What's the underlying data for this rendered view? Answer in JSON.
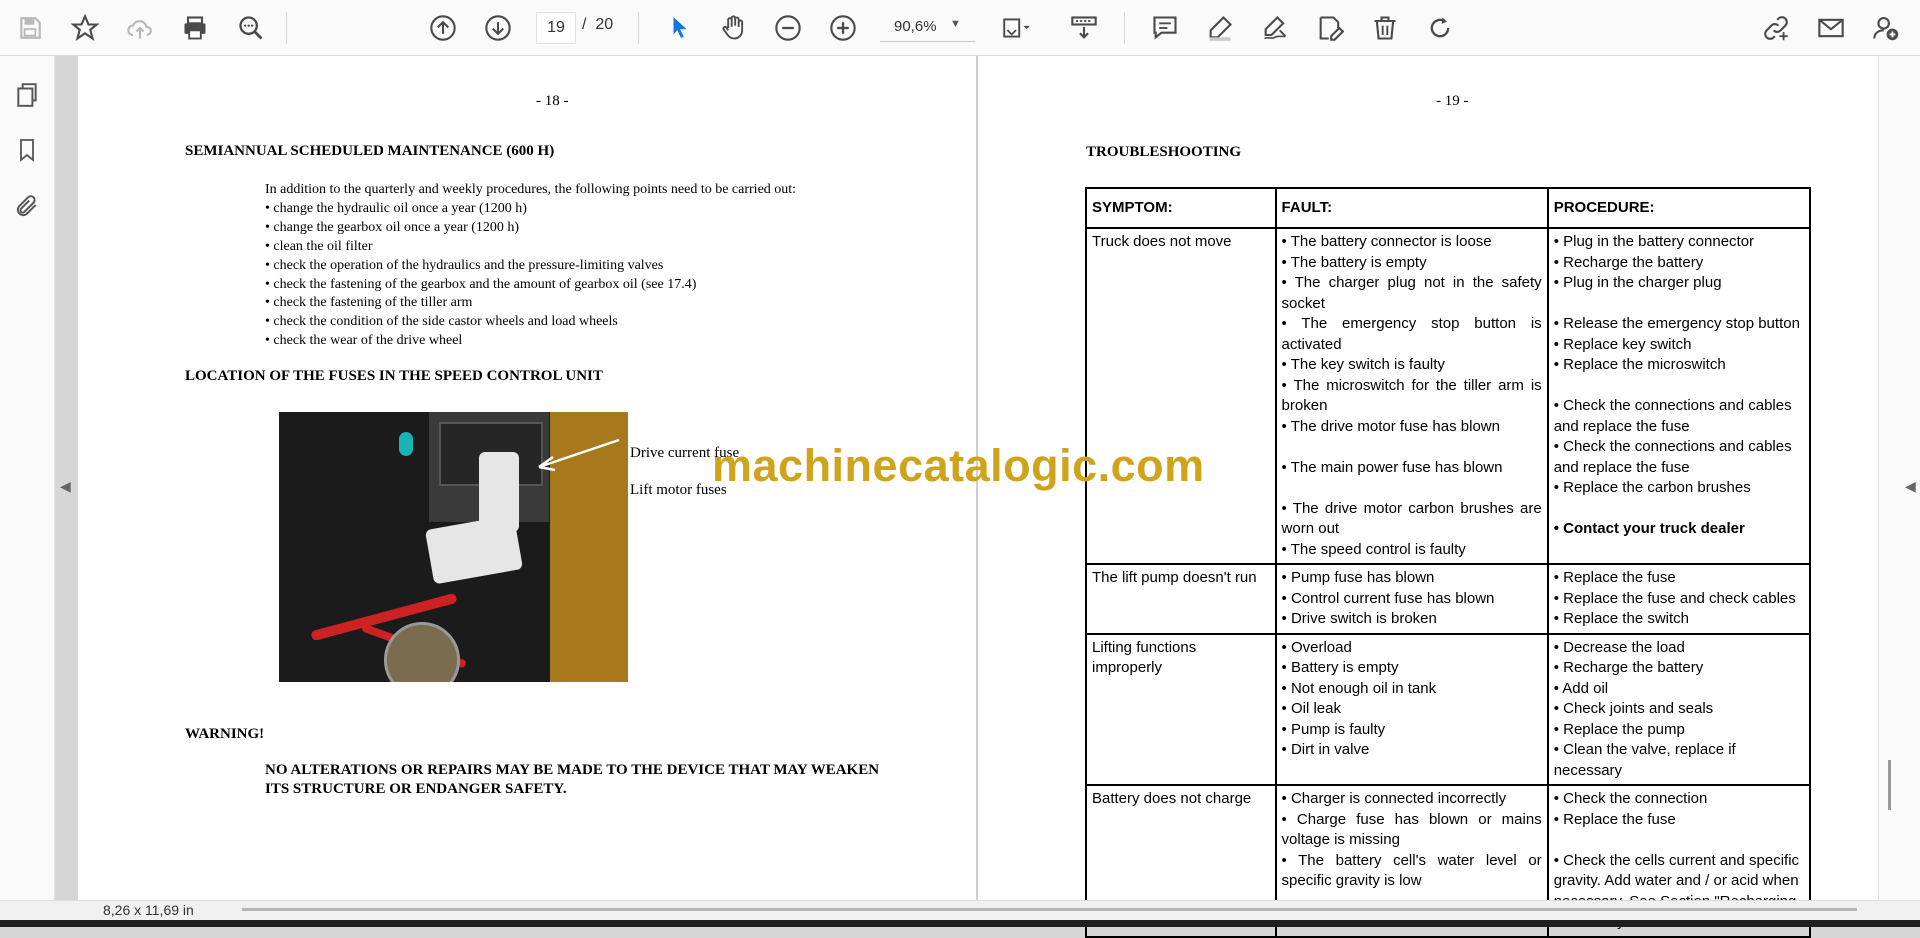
{
  "toolbar": {
    "page_current": "19",
    "page_separator": "/",
    "page_total": "20",
    "zoom": "90,6%",
    "icons": [
      "save-icon",
      "star-icon",
      "cloud-upload-icon",
      "print-icon",
      "zoom-search-icon",
      "page-up-icon",
      "page-down-icon",
      "select-arrow-icon",
      "hand-icon",
      "zoom-out-icon",
      "zoom-in-icon",
      "fit-page-icon",
      "scroll-mode-icon",
      "comment-icon",
      "highlight-icon",
      "sign-icon",
      "edit-pdf-icon",
      "delete-icon",
      "rotate-icon",
      "share-link-icon",
      "email-icon",
      "add-user-icon"
    ]
  },
  "left_panel": [
    "pages-icon",
    "bookmark-icon",
    "attachment-icon"
  ],
  "page18": {
    "number": "- 18 -",
    "heading1": "SEMIANNUAL SCHEDULED MAINTENANCE (600 H)",
    "lines": [
      "In addition to the quarterly and weekly procedures, the following points need to be carried out:",
      "• change the hydraulic oil once a year (1200 h)",
      "• change the gearbox oil once a year (1200 h)",
      "• clean the oil filter",
      "• check the operation of the hydraulics and the pressure-limiting valves",
      "• check the fastening of the gearbox and the amount of gearbox oil (see 17.4)",
      "• check the fastening of the tiller arm",
      "• check the condition of the side castor wheels and load wheels",
      "• check the wear of the drive wheel"
    ],
    "heading2": "LOCATION OF THE FUSES IN THE SPEED CONTROL UNIT",
    "caption1": "Drive current fuse",
    "caption2": "Lift motor fuses",
    "warning": "WARNING!",
    "warning_text_1": "NO ALTERATIONS OR REPAIRS MAY BE MADE TO THE DEVICE THAT MAY WEAKEN",
    "warning_text_2": "ITS STRUCTURE OR ENDANGER SAFETY."
  },
  "page19": {
    "number": "- 19 -",
    "heading": "TROUBLESHOOTING",
    "table": {
      "headers": [
        "SYMPTOM:",
        "FAULT:",
        "PROCEDURE:"
      ],
      "rows": [
        {
          "symptom": "Truck does not move",
          "faults": [
            "• The battery connector is loose",
            "• The battery is empty",
            "• The charger plug not in the safety socket",
            "• The emergency stop button is activated",
            "• The key switch is faulty",
            "• The microswitch for the tiller arm is broken",
            "• The drive motor fuse has blown",
            "",
            "• The main power fuse has blown",
            "",
            "• The drive motor carbon brushes are worn out",
            "• The speed control is faulty"
          ],
          "procedures": [
            "• Plug in the battery connector",
            "• Recharge the battery",
            "• Plug in the charger plug",
            "",
            "• Release the emergency stop button",
            "• Replace key switch",
            "• Replace the microswitch",
            "",
            "• Check the connections and cables and replace the fuse",
            "• Check the connections and cables and replace the fuse",
            "• Replace the carbon brushes",
            "",
            "• Contact your truck dealer"
          ]
        },
        {
          "symptom": "The lift pump doesn't run",
          "faults": [
            "• Pump fuse has blown",
            "• Control current fuse has blown",
            "• Drive switch is broken"
          ],
          "procedures": [
            "• Replace the fuse",
            "• Replace the fuse and check cables",
            "• Replace the switch"
          ]
        },
        {
          "symptom": "Lifting functions improperly",
          "faults": [
            "• Overload",
            "• Battery is empty",
            "• Not enough oil in tank",
            "• Oil leak",
            "• Pump is faulty",
            "• Dirt in valve"
          ],
          "procedures": [
            "• Decrease the load",
            "• Recharge the battery",
            "• Add oil",
            "• Check joints and seals",
            "• Replace the pump",
            "• Clean the valve, replace if necessary"
          ]
        },
        {
          "symptom": "Battery does not charge",
          "faults": [
            "• Charger is connected incorrectly",
            "• Charge fuse has blown or mains voltage is missing",
            "• The battery cell's water level or specific gravity is low"
          ],
          "procedures": [
            "• Check the connection",
            "• Replace the fuse",
            "",
            "• Check the cells current and specific gravity. Add water and / or acid when necessary. See Section \"Recharging the battery\""
          ]
        }
      ]
    }
  },
  "watermark": "machinecatalogic.com",
  "status": {
    "page_size": "8,26 x 11,69 in"
  }
}
